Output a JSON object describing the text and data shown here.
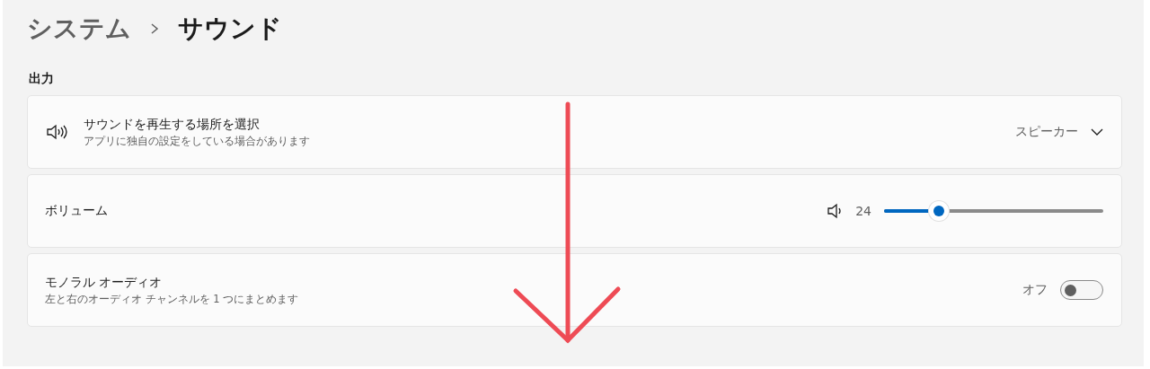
{
  "breadcrumb": [
    {
      "label": "システム",
      "selected": false
    },
    {
      "label": "サウンド",
      "selected": true
    }
  ],
  "section_title": "出力",
  "settings": [
    {
      "kind": "dropdown",
      "title": "サウンドを再生する場所を選択",
      "subtitle": "アプリに独自の設定をしている場合があります",
      "value": "スピーカー"
    },
    {
      "kind": "slider",
      "title": "ボリューム",
      "reading": "24",
      "level": 0.25
    },
    {
      "kind": "toggle",
      "title": "モノラル オーディオ",
      "subtitle": "左と右のオーディオ チャンネルを 1 つにまとめます",
      "state_label": "オフ",
      "on": false
    }
  ],
  "annotation": {
    "kind": "arrow"
  }
}
